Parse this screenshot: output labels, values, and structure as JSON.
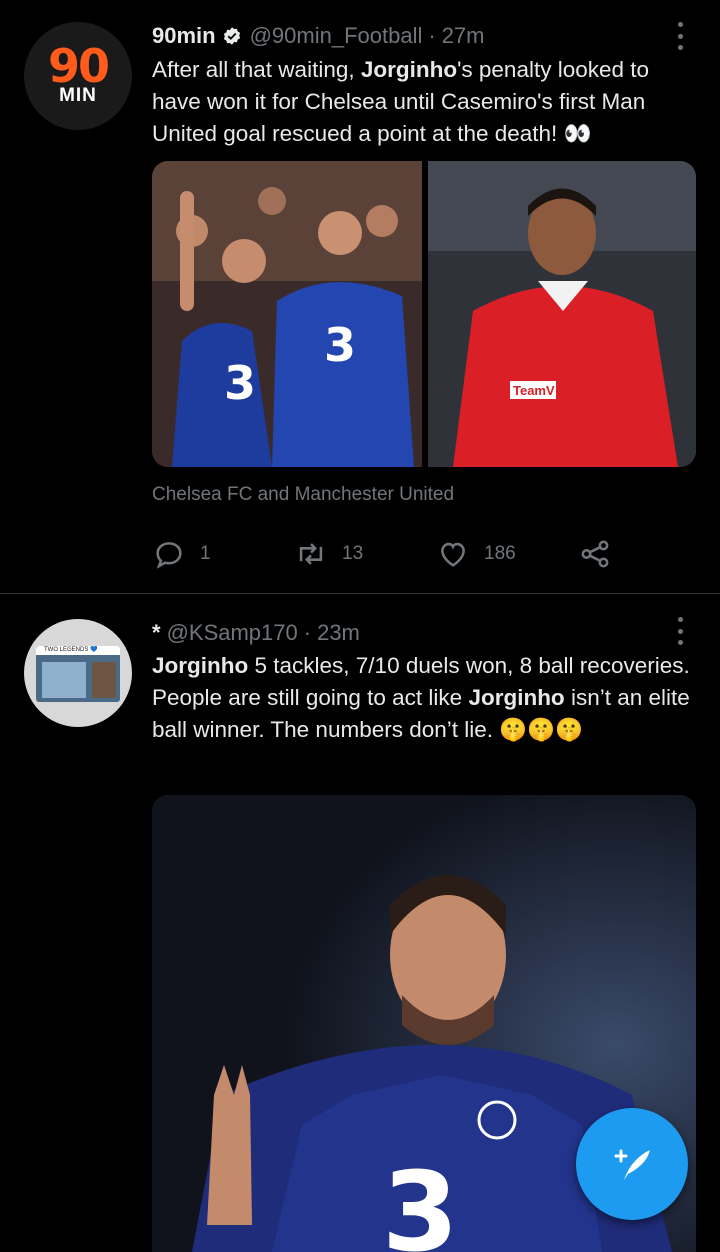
{
  "tweets": [
    {
      "display_name": "90min",
      "handle": "@90min_Football",
      "time": "27m",
      "avatar_logo_top": "90",
      "avatar_logo_bottom": "MIN",
      "text_parts": [
        "After all that waiting, ",
        "Jorginho",
        "'s penalty looked to have won it for Chelsea until Casemiro's first Man United goal rescued a point at the death! 👀"
      ],
      "media_caption": "Chelsea FC and Manchester United",
      "replies": "1",
      "retweets": "13",
      "likes": "186"
    },
    {
      "display_name": "*",
      "handle": "@KSamp170",
      "time": "23m",
      "avatar_banner": "TWO LEGENDS 💙",
      "text_parts": [
        "Jorginho",
        " 5 tackles, 7/10 duels won, 8 ball recoveries. People are still going to act like ",
        "Jorginho",
        " isn’t an elite ball winner. The numbers don’t lie. 🤫🤫🤫"
      ]
    }
  ],
  "colors": {
    "background": "#000000",
    "text_primary": "#e7e9ea",
    "text_secondary": "#71767b",
    "accent": "#1d9bf0",
    "chelsea_blue": "#1f3a93",
    "united_red": "#da1f26"
  },
  "icons": {
    "reply": "reply-icon",
    "retweet": "retweet-icon",
    "like": "heart-icon",
    "share": "share-icon",
    "more": "more-icon",
    "verified": "verified-badge-icon",
    "compose": "compose-tweet-icon"
  }
}
